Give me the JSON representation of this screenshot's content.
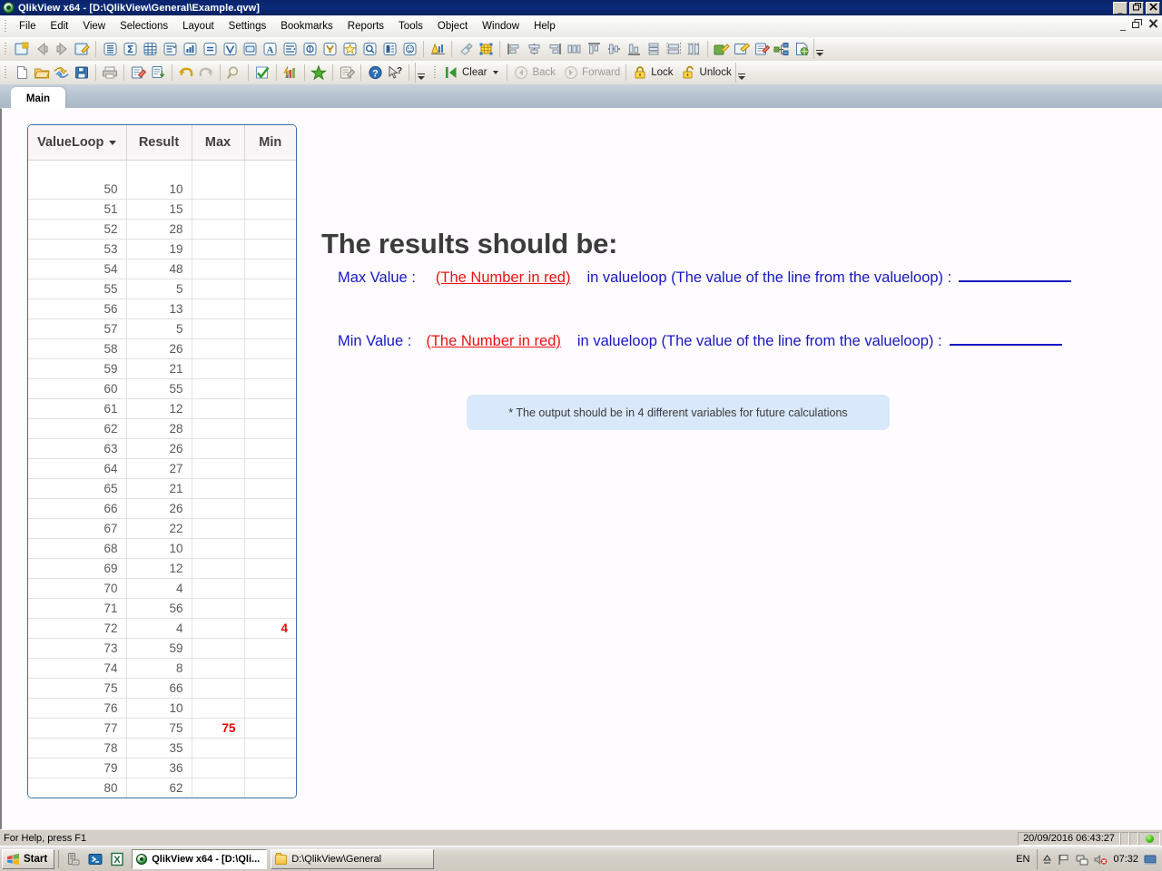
{
  "window": {
    "title": "QlikView x64 - [D:\\QlikView\\General\\Example.qvw]",
    "logo_icon": "qlikview-logo-icon",
    "minimize_label": "_",
    "maximize_label": "❐",
    "close_label": "✕",
    "mdi_minimize_label": "_",
    "mdi_restore_label": "❐",
    "mdi_close_label": "✕"
  },
  "menubar": {
    "items": [
      {
        "label": "File"
      },
      {
        "label": "Edit"
      },
      {
        "label": "View"
      },
      {
        "label": "Selections"
      },
      {
        "label": "Layout"
      },
      {
        "label": "Settings"
      },
      {
        "label": "Bookmarks"
      },
      {
        "label": "Reports"
      },
      {
        "label": "Tools"
      },
      {
        "label": "Object"
      },
      {
        "label": "Window"
      },
      {
        "label": "Help"
      }
    ]
  },
  "toolbar_design": {
    "groups": [
      {
        "icons": [
          "new-sheet-icon",
          "previous-sheet-icon",
          "next-sheet-icon",
          "sheet-properties-icon"
        ]
      },
      {
        "icons": [
          "list-box-icon",
          "statistics-box-icon",
          "table-box-icon",
          "multi-box-icon",
          "chart-icon",
          "input-box-icon",
          "current-selections-icon",
          "text-object-icon",
          "button-object-icon",
          "slider-object-icon",
          "bookmark-object-icon",
          "search-object-icon",
          "container-object-icon",
          "custom-object-icon"
        ]
      },
      {
        "icons": [
          "edit-module-icon"
        ]
      },
      {
        "icons": [
          "clear-format-icon",
          "grid-icon"
        ]
      },
      {
        "icons": [
          "align-left-icon",
          "align-center-h-icon",
          "align-right-icon",
          "distribute-h-icon",
          "align-top-icon",
          "align-middle-icon",
          "align-bottom-icon",
          "distribute-v-icon",
          "same-width-icon",
          "same-height-icon"
        ]
      },
      {
        "icons": [
          "edit-script-icon",
          "reload-icon",
          "table-viewer-icon",
          "expand-icon",
          "publish-icon"
        ]
      }
    ],
    "overflow_icon": "toolbar-overflow-icon"
  },
  "toolbar_standard": {
    "groups": [
      {
        "icons": [
          "new-document-icon",
          "open-document-icon",
          "refresh-icon",
          "save-icon"
        ]
      },
      {
        "icons": [
          "print-icon"
        ]
      },
      {
        "icons": [
          "edit-script-icon",
          "reload-data-icon"
        ]
      },
      {
        "icons": [
          "undo-icon",
          "redo-icon"
        ]
      },
      {
        "icons": [
          "search-icon"
        ]
      },
      {
        "icons": [
          "select-all-icon"
        ]
      },
      {
        "icons": [
          "quick-chart-icon"
        ]
      },
      {
        "icons": [
          "add-bookmark-icon"
        ]
      },
      {
        "icons": [
          "edit-module-icon"
        ]
      },
      {
        "icons": [
          "help-icon",
          "context-help-icon"
        ]
      }
    ],
    "overflow_icon": "toolbar-overflow-icon"
  },
  "toolbar_selection": {
    "clear_label": "Clear",
    "clear_icon": "clear-selections-icon",
    "back_label": "Back",
    "back_icon": "back-arrow-icon",
    "back_enabled": false,
    "forward_label": "Forward",
    "forward_icon": "forward-arrow-icon",
    "forward_enabled": false,
    "lock_label": "Lock",
    "lock_icon": "lock-closed-icon",
    "unlock_label": "Unlock",
    "unlock_icon": "lock-open-icon",
    "overflow_icon": "toolbar-overflow-icon"
  },
  "tabs": [
    {
      "label": "Main",
      "active": true
    }
  ],
  "table": {
    "sort_icon": "sort-descending-caret-icon",
    "columns": [
      "ValueLoop",
      "Result",
      "Max",
      "Min"
    ],
    "rows": [
      {
        "valueloop": "50",
        "result": "10",
        "max": "",
        "min": ""
      },
      {
        "valueloop": "51",
        "result": "15",
        "max": "",
        "min": ""
      },
      {
        "valueloop": "52",
        "result": "28",
        "max": "",
        "min": ""
      },
      {
        "valueloop": "53",
        "result": "19",
        "max": "",
        "min": ""
      },
      {
        "valueloop": "54",
        "result": "48",
        "max": "",
        "min": ""
      },
      {
        "valueloop": "55",
        "result": "5",
        "max": "",
        "min": ""
      },
      {
        "valueloop": "56",
        "result": "13",
        "max": "",
        "min": ""
      },
      {
        "valueloop": "57",
        "result": "5",
        "max": "",
        "min": ""
      },
      {
        "valueloop": "58",
        "result": "26",
        "max": "",
        "min": ""
      },
      {
        "valueloop": "59",
        "result": "21",
        "max": "",
        "min": ""
      },
      {
        "valueloop": "60",
        "result": "55",
        "max": "",
        "min": ""
      },
      {
        "valueloop": "61",
        "result": "12",
        "max": "",
        "min": ""
      },
      {
        "valueloop": "62",
        "result": "28",
        "max": "",
        "min": ""
      },
      {
        "valueloop": "63",
        "result": "26",
        "max": "",
        "min": ""
      },
      {
        "valueloop": "64",
        "result": "27",
        "max": "",
        "min": ""
      },
      {
        "valueloop": "65",
        "result": "21",
        "max": "",
        "min": ""
      },
      {
        "valueloop": "66",
        "result": "26",
        "max": "",
        "min": ""
      },
      {
        "valueloop": "67",
        "result": "22",
        "max": "",
        "min": ""
      },
      {
        "valueloop": "68",
        "result": "10",
        "max": "",
        "min": ""
      },
      {
        "valueloop": "69",
        "result": "12",
        "max": "",
        "min": ""
      },
      {
        "valueloop": "70",
        "result": "4",
        "max": "",
        "min": ""
      },
      {
        "valueloop": "71",
        "result": "56",
        "max": "",
        "min": ""
      },
      {
        "valueloop": "72",
        "result": "4",
        "max": "",
        "min": "4"
      },
      {
        "valueloop": "73",
        "result": "59",
        "max": "",
        "min": ""
      },
      {
        "valueloop": "74",
        "result": "8",
        "max": "",
        "min": ""
      },
      {
        "valueloop": "75",
        "result": "66",
        "max": "",
        "min": ""
      },
      {
        "valueloop": "76",
        "result": "10",
        "max": "",
        "min": ""
      },
      {
        "valueloop": "77",
        "result": "75",
        "max": "75",
        "min": ""
      },
      {
        "valueloop": "78",
        "result": "35",
        "max": "",
        "min": ""
      },
      {
        "valueloop": "79",
        "result": "36",
        "max": "",
        "min": ""
      },
      {
        "valueloop": "80",
        "result": "62",
        "max": "",
        "min": ""
      }
    ],
    "highlight_color": "#ee0000"
  },
  "content": {
    "heading": "The results should be:",
    "max_line": {
      "label": "Max Value :",
      "red_text": "(The Number in red)",
      "tail": "in valueloop (The value of the line from the valueloop) :"
    },
    "min_line": {
      "label": "Min Value :",
      "red_text": "(The Number in red)",
      "tail": "in valueloop (The value of the line from the valueloop) :"
    },
    "note": "* The output should be in 4 different variables for future calculations",
    "text_color": "#1717c0",
    "red_color": "#ee1111",
    "note_bg": "#d9e8fb"
  },
  "statusbar": {
    "help_text": "For Help, press F1",
    "timestamp": "20/09/2016 06:43:27",
    "status_indicator_icon": "green-status-dot-icon"
  },
  "taskbar": {
    "start_label": "Start",
    "start_icon": "windows-flag-icon",
    "quicklaunch": [
      {
        "icon": "server-manager-icon"
      },
      {
        "icon": "powershell-icon"
      },
      {
        "icon": "excel-icon"
      }
    ],
    "items": [
      {
        "label": "QlikView x64 - [D:\\Qli...",
        "icon": "qlikview-logo-icon",
        "active": true
      },
      {
        "label": "D:\\QlikView\\General",
        "icon": "folder-icon",
        "active": false
      }
    ],
    "tray": {
      "language": "EN",
      "icons": [
        "action-center-icon",
        "flag-icon",
        "network-icon",
        "volume-muted-icon"
      ],
      "clock": "07:32",
      "show-desktop_icon": "show-desktop-icon"
    }
  }
}
